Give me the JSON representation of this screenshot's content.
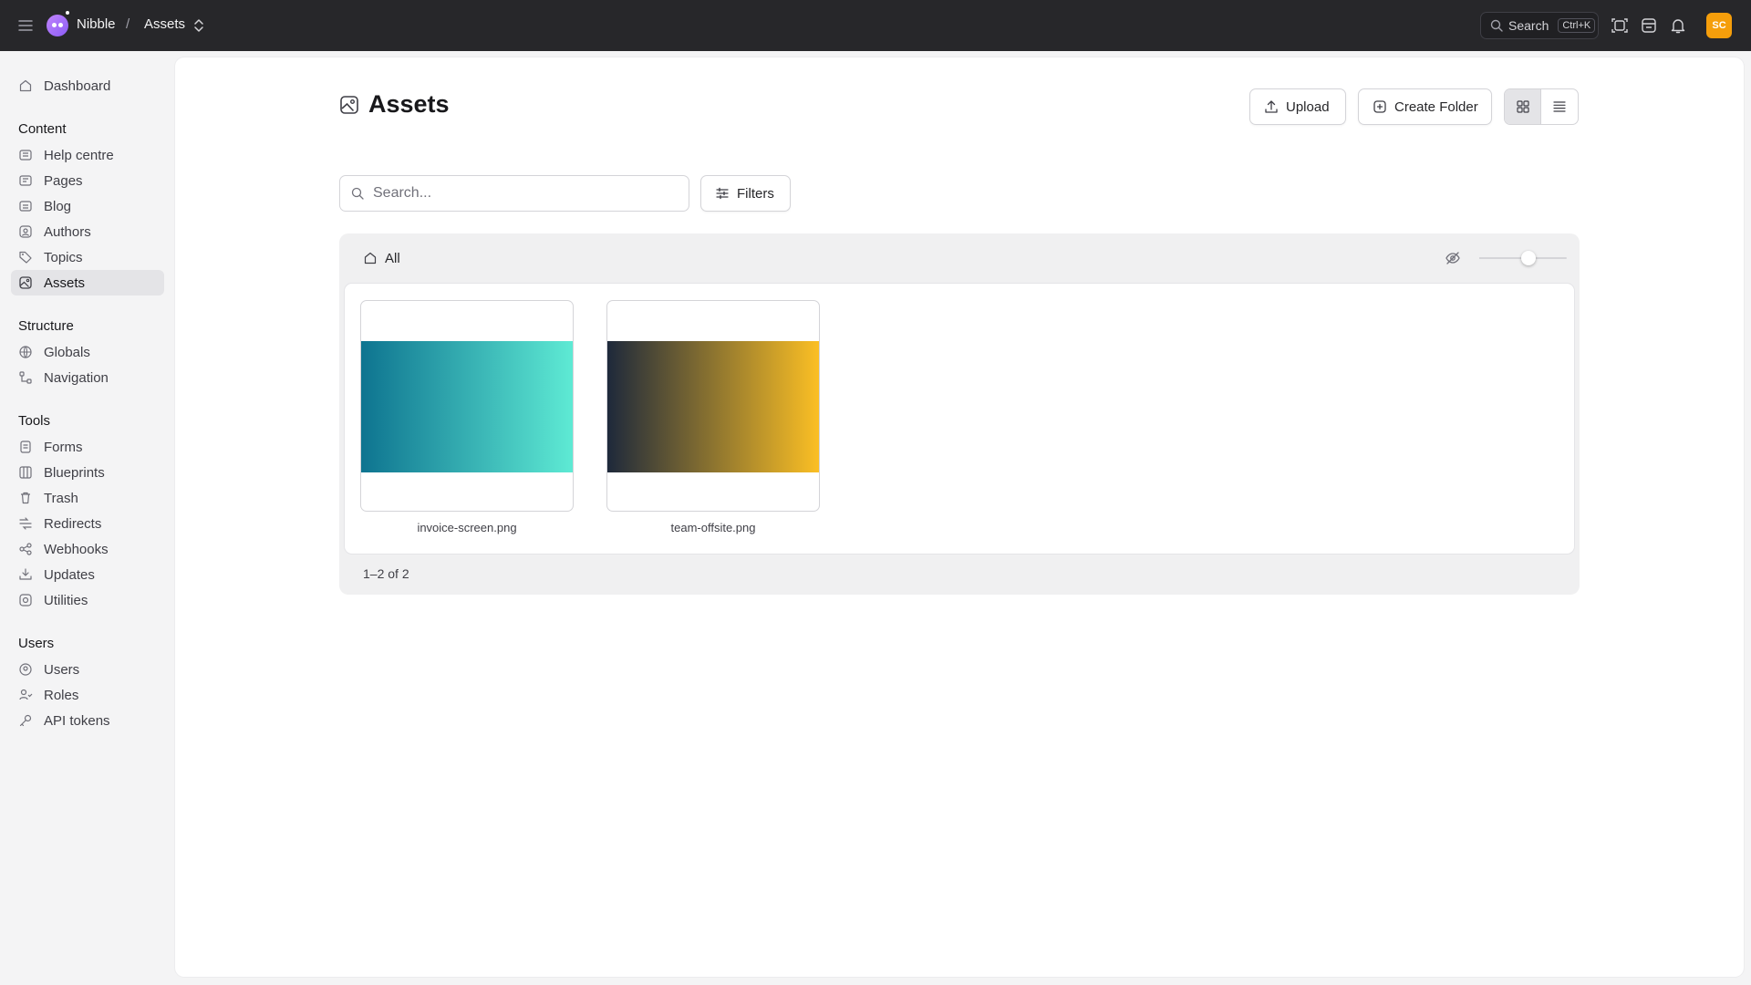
{
  "topbar": {
    "site_name": "Nibble",
    "separator": "/",
    "current_section": "Assets",
    "search_label": "Search",
    "search_shortcut": "Ctrl+K",
    "avatar_initials": "SC",
    "avatar_color": "#f59e0b"
  },
  "sidebar": {
    "dashboard": "Dashboard",
    "sections": [
      {
        "title": "Content",
        "items": [
          "Help centre",
          "Pages",
          "Blog",
          "Authors",
          "Topics",
          "Assets"
        ]
      },
      {
        "title": "Structure",
        "items": [
          "Globals",
          "Navigation"
        ]
      },
      {
        "title": "Tools",
        "items": [
          "Forms",
          "Blueprints",
          "Trash",
          "Redirects",
          "Webhooks",
          "Updates",
          "Utilities"
        ]
      },
      {
        "title": "Users",
        "items": [
          "Users",
          "Roles",
          "API tokens"
        ]
      }
    ],
    "active_item": "Assets"
  },
  "main": {
    "title": "Assets",
    "upload_label": "Upload",
    "create_folder_label": "Create Folder",
    "view_mode": "grid",
    "search_placeholder": "Search...",
    "filters_label": "Filters",
    "breadcrumb_root": "All",
    "thumbnail_size_level": 0.58,
    "assets": [
      {
        "filename": "invoice-screen.png",
        "gradient": [
          "#0e7490",
          "#5eead4"
        ]
      },
      {
        "filename": "team-offsite.png",
        "gradient": [
          "#1e293b",
          "#fbbf24"
        ]
      }
    ],
    "pagination": "1–2 of 2"
  }
}
